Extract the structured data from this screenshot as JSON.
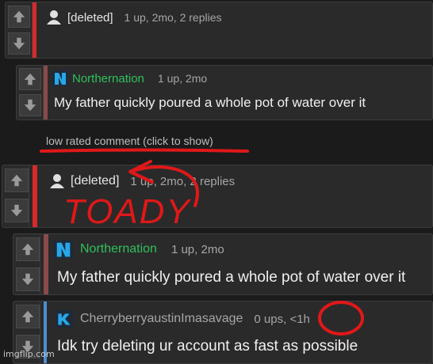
{
  "comments": [
    {
      "username": "[deleted]",
      "stats": "1 up, 2mo, 2 replies",
      "avatar": "default-user-icon"
    },
    {
      "username": "Northernation",
      "stats": "1 up, 2mo",
      "avatar": "northernation-logo-icon",
      "text": "My father quickly poured a whole pot of water over it"
    },
    {
      "username": "[deleted]",
      "stats": "1 up, 2mo, 2 replies",
      "avatar": "default-user-icon"
    },
    {
      "username": "Northernation",
      "stats": "1 up, 2mo",
      "avatar": "northernation-logo-icon",
      "text": "My father quickly poured a whole pot of water over it"
    },
    {
      "username": "CherryberryaustinImasavage",
      "stats": "0 ups, <1h",
      "avatar": "user-badge-icon",
      "text": "Idk try deleting ur account as fast as possible"
    }
  ],
  "low_rated_label": "low rated comment (click to show)",
  "annotation_text": "TOADY",
  "watermark": "imgflip.com",
  "colors": {
    "background": "#1b1b1c",
    "panel": "#2a2a2b",
    "accent_red": "#d52b2b",
    "accent_blue": "#4b8fd0",
    "username_green": "#2fc05a",
    "annotation_red": "#e01818"
  },
  "icons": {
    "upvote": "up-arrow-icon",
    "downvote": "down-arrow-icon"
  }
}
